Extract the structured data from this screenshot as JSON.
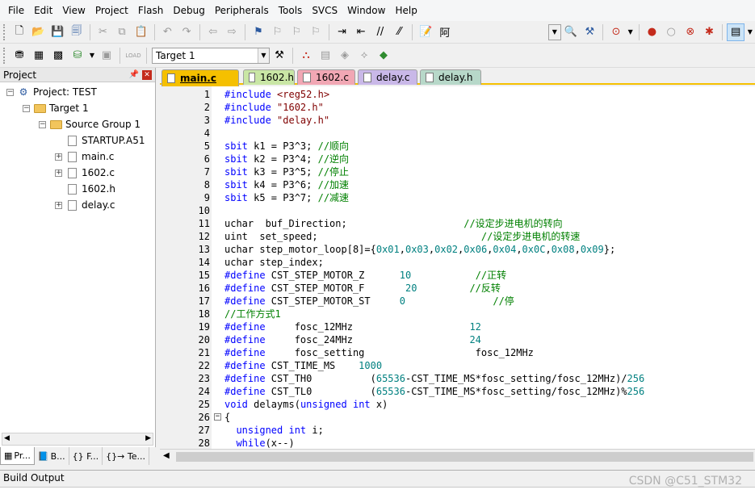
{
  "menu": [
    "File",
    "Edit",
    "View",
    "Project",
    "Flash",
    "Debug",
    "Peripherals",
    "Tools",
    "SVCS",
    "Window",
    "Help"
  ],
  "toolbar1": {
    "find_glyph": "阿"
  },
  "toolbar2": {
    "target_select": "Target 1",
    "load_label": "LOAD"
  },
  "project_panel": {
    "title": "Project",
    "tree": {
      "project": "Project: TEST",
      "target": "Target 1",
      "group": "Source Group 1",
      "files": [
        "STARTUP.A51",
        "main.c",
        "1602.c",
        "1602.h",
        "delay.c"
      ]
    },
    "tabs": [
      "Pr...",
      "B...",
      "{} F...",
      "{}→ Te..."
    ]
  },
  "editor": {
    "tabs": [
      {
        "label": "main.c",
        "color": "#f5c000",
        "active": true
      },
      {
        "label": "1602.h",
        "color": "#c9e6a5",
        "active": false
      },
      {
        "label": "1602.c",
        "color": "#f1a7b4",
        "active": false
      },
      {
        "label": "delay.c",
        "color": "#c9b8e8",
        "active": false
      },
      {
        "label": "delay.h",
        "color": "#b7d8c9",
        "active": false
      }
    ],
    "lines": [
      {
        "n": "1",
        "t": [
          [
            "pp",
            "#include "
          ],
          [
            "str",
            "<reg52.h>"
          ]
        ]
      },
      {
        "n": "2",
        "t": [
          [
            "pp",
            "#include "
          ],
          [
            "str",
            "\"1602.h\""
          ]
        ]
      },
      {
        "n": "3",
        "t": [
          [
            "pp",
            "#include "
          ],
          [
            "str",
            "\"delay.h\""
          ]
        ]
      },
      {
        "n": "4",
        "t": []
      },
      {
        "n": "5",
        "t": [
          [
            "kw",
            "sbit"
          ],
          [
            "",
            " k1 = P3^3; "
          ],
          [
            "cm",
            "//顺向"
          ]
        ]
      },
      {
        "n": "6",
        "t": [
          [
            "kw",
            "sbit"
          ],
          [
            "",
            " k2 = P3^4; "
          ],
          [
            "cm",
            "//逆向"
          ]
        ]
      },
      {
        "n": "7",
        "t": [
          [
            "kw",
            "sbit"
          ],
          [
            "",
            " k3 = P3^5; "
          ],
          [
            "cm",
            "//停止"
          ]
        ]
      },
      {
        "n": "8",
        "t": [
          [
            "kw",
            "sbit"
          ],
          [
            "",
            " k4 = P3^6; "
          ],
          [
            "cm",
            "//加速"
          ]
        ]
      },
      {
        "n": "9",
        "t": [
          [
            "kw",
            "sbit"
          ],
          [
            "",
            " k5 = P3^7; "
          ],
          [
            "cm",
            "//减速"
          ]
        ]
      },
      {
        "n": "10",
        "t": []
      },
      {
        "n": "11",
        "t": [
          [
            "",
            "uchar  buf_Direction;                    "
          ],
          [
            "cm",
            "//设定步进电机的转向"
          ]
        ]
      },
      {
        "n": "12",
        "t": [
          [
            "",
            "uint  set_speed;                            "
          ],
          [
            "cm",
            "//设定步进电机的转速"
          ]
        ]
      },
      {
        "n": "13",
        "t": [
          [
            "",
            "uchar step_motor_loop[8]={"
          ],
          [
            "num",
            "0x01"
          ],
          [
            "",
            ","
          ],
          [
            "num",
            "0x03"
          ],
          [
            "",
            ","
          ],
          [
            "num",
            "0x02"
          ],
          [
            "",
            ","
          ],
          [
            "num",
            "0x06"
          ],
          [
            "",
            ","
          ],
          [
            "num",
            "0x04"
          ],
          [
            "",
            ","
          ],
          [
            "num",
            "0x0C"
          ],
          [
            "",
            ","
          ],
          [
            "num",
            "0x08"
          ],
          [
            "",
            ","
          ],
          [
            "num",
            "0x09"
          ],
          [
            "",
            "};"
          ]
        ]
      },
      {
        "n": "14",
        "t": [
          [
            "",
            "uchar step_index;"
          ]
        ]
      },
      {
        "n": "15",
        "t": [
          [
            "pp",
            "#define"
          ],
          [
            "",
            " CST_STEP_MOTOR_Z      "
          ],
          [
            "num",
            "10"
          ],
          [
            "",
            "           "
          ],
          [
            "cm",
            "//正转"
          ]
        ]
      },
      {
        "n": "16",
        "t": [
          [
            "pp",
            "#define"
          ],
          [
            "",
            " CST_STEP_MOTOR_F       "
          ],
          [
            "num",
            "20"
          ],
          [
            "",
            "         "
          ],
          [
            "cm",
            "//反转"
          ]
        ]
      },
      {
        "n": "17",
        "t": [
          [
            "pp",
            "#define"
          ],
          [
            "",
            " CST_STEP_MOTOR_ST     "
          ],
          [
            "num",
            "0"
          ],
          [
            "",
            "               "
          ],
          [
            "cm",
            "//停"
          ]
        ]
      },
      {
        "n": "18",
        "t": [
          [
            "cm",
            "//工作方式1"
          ]
        ]
      },
      {
        "n": "19",
        "t": [
          [
            "pp",
            "#define"
          ],
          [
            "",
            "     fosc_12MHz                    "
          ],
          [
            "num",
            "12"
          ]
        ]
      },
      {
        "n": "20",
        "t": [
          [
            "pp",
            "#define"
          ],
          [
            "",
            "     fosc_24MHz                    "
          ],
          [
            "num",
            "24"
          ]
        ]
      },
      {
        "n": "21",
        "t": [
          [
            "pp",
            "#define"
          ],
          [
            "",
            "     fosc_setting                   fosc_12MHz"
          ]
        ]
      },
      {
        "n": "22",
        "t": [
          [
            "pp",
            "#define"
          ],
          [
            "",
            " CST_TIME_MS    "
          ],
          [
            "num",
            "1000"
          ]
        ]
      },
      {
        "n": "23",
        "t": [
          [
            "pp",
            "#define"
          ],
          [
            "",
            " CST_TH0          ("
          ],
          [
            "num",
            "65536"
          ],
          [
            "",
            "-CST_TIME_MS*fosc_setting/fosc_12MHz)/"
          ],
          [
            "num",
            "256"
          ]
        ]
      },
      {
        "n": "24",
        "t": [
          [
            "pp",
            "#define"
          ],
          [
            "",
            " CST_TL0          ("
          ],
          [
            "num",
            "65536"
          ],
          [
            "",
            "-CST_TIME_MS*fosc_setting/fosc_12MHz)%"
          ],
          [
            "num",
            "256"
          ]
        ]
      },
      {
        "n": "25",
        "t": [
          [
            "kw",
            "void"
          ],
          [
            "",
            " delayms("
          ],
          [
            "kw",
            "unsigned"
          ],
          [
            "",
            " "
          ],
          [
            "kw",
            "int"
          ],
          [
            "",
            " x)"
          ]
        ]
      },
      {
        "n": "26",
        "t": [
          [
            "",
            "{"
          ]
        ],
        "fold": "−"
      },
      {
        "n": "27",
        "t": [
          [
            "",
            "  "
          ],
          [
            "kw",
            "unsigned"
          ],
          [
            "",
            " "
          ],
          [
            "kw",
            "int"
          ],
          [
            "",
            " i;"
          ]
        ]
      },
      {
        "n": "28",
        "t": [
          [
            "",
            "  "
          ],
          [
            "kw",
            "while"
          ],
          [
            "",
            "(x--)"
          ]
        ]
      }
    ]
  },
  "build_output": {
    "title": "Build Output"
  },
  "watermark": "CSDN @C51_STM32"
}
